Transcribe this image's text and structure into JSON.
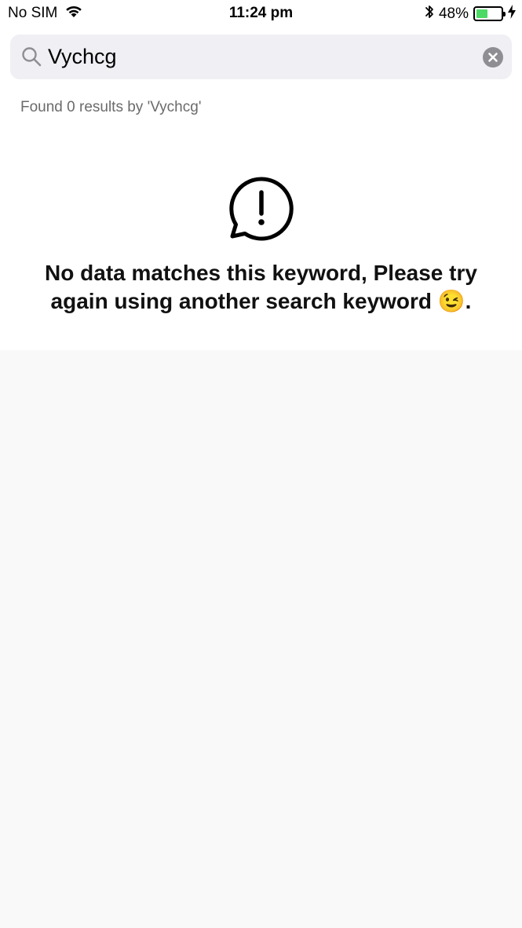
{
  "status_bar": {
    "carrier": "No SIM",
    "time": "11:24 pm",
    "battery_percent": "48%",
    "battery_level": 0.48,
    "icons": [
      "wifi-icon",
      "bluetooth-icon",
      "battery-icon",
      "charging-icon"
    ]
  },
  "search": {
    "value": "Vychcg",
    "icon": "search-icon",
    "clear_icon": "clear-icon"
  },
  "results": {
    "found_text": "Found 0 results by 'Vychcg'"
  },
  "empty_state": {
    "icon": "alert-bubble-icon",
    "message": "No data matches this keyword, Please try again using another search keyword 😉."
  },
  "colors": {
    "battery_fill": "#4cd964",
    "search_bg": "#efeff4",
    "page_bg": "#f9f9f9"
  }
}
